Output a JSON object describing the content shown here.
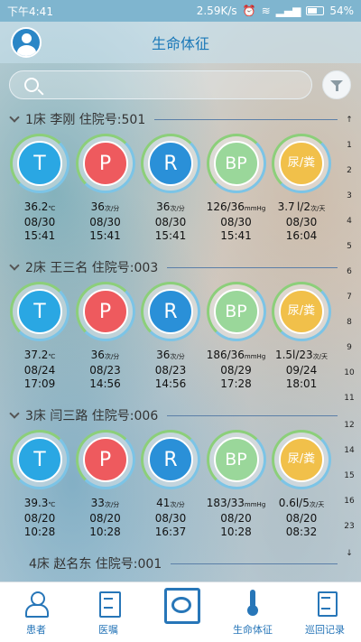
{
  "status_bar": {
    "time": "下午4:41",
    "speed": "2.59K/s",
    "icons": [
      "alarm-icon",
      "wifi-icon",
      "signal-icon"
    ],
    "battery": "54%"
  },
  "header": {
    "title": "生命体征",
    "avatar_icon": "user-avatar-icon"
  },
  "search": {
    "placeholder": "",
    "value": "",
    "filter_icon": "filter-icon"
  },
  "patients": [
    {
      "title": "1床 李刚 住院号:501",
      "vitals": [
        {
          "symbol": "T",
          "value": "36.2",
          "unit": "℃",
          "date": "08/30",
          "time": "15:41"
        },
        {
          "symbol": "P",
          "value": "36",
          "unit": "次/分",
          "date": "08/30",
          "time": "15:41"
        },
        {
          "symbol": "R",
          "value": "36",
          "unit": "次/分",
          "date": "08/30",
          "time": "15:41"
        },
        {
          "symbol": "BP",
          "value": "126/36",
          "unit": "mmHg",
          "date": "08/30",
          "time": "15:41"
        },
        {
          "symbol": "尿/粪",
          "value": "3.7 l/2",
          "unit": "次/天",
          "date": "08/30",
          "time": "16:04"
        }
      ]
    },
    {
      "title": "2床 王三名 住院号:003",
      "vitals": [
        {
          "symbol": "T",
          "value": "37.2",
          "unit": "℃",
          "date": "08/24",
          "time": "17:09"
        },
        {
          "symbol": "P",
          "value": "36",
          "unit": "次/分",
          "date": "08/23",
          "time": "14:56"
        },
        {
          "symbol": "R",
          "value": "36",
          "unit": "次/分",
          "date": "08/23",
          "time": "14:56"
        },
        {
          "symbol": "BP",
          "value": "186/36",
          "unit": "mmHg",
          "date": "08/29",
          "time": "17:28"
        },
        {
          "symbol": "尿/粪",
          "value": "1.5l/23",
          "unit": "次/天",
          "date": "09/24",
          "time": "18:01"
        }
      ]
    },
    {
      "title": "3床 闫三路 住院号:006",
      "vitals": [
        {
          "symbol": "T",
          "value": "39.3",
          "unit": "℃",
          "date": "08/20",
          "time": "10:28"
        },
        {
          "symbol": "P",
          "value": "33",
          "unit": "次/分",
          "date": "08/20",
          "time": "10:28"
        },
        {
          "symbol": "R",
          "value": "41",
          "unit": "次/分",
          "date": "08/30",
          "time": "16:37"
        },
        {
          "symbol": "BP",
          "value": "183/33",
          "unit": "mmHg",
          "date": "08/20",
          "time": "10:28"
        },
        {
          "symbol": "尿/粪",
          "value": "0.6l/5",
          "unit": "次/天",
          "date": "08/20",
          "time": "08:32"
        }
      ]
    },
    {
      "title": "4床 赵名东 住院号:001",
      "vitals": []
    }
  ],
  "side_index": [
    "↑",
    "1",
    "2",
    "3",
    "4",
    "5",
    "6",
    "7",
    "8",
    "9",
    "10",
    "11",
    "12",
    "14",
    "15",
    "16",
    "23",
    "↓"
  ],
  "bottom_nav": [
    {
      "label": "患者",
      "icon": "patient-icon"
    },
    {
      "label": "医嘱",
      "icon": "medical-order-icon"
    },
    {
      "label": "",
      "icon": "scan-icon"
    },
    {
      "label": "生命体征",
      "icon": "thermometer-icon"
    },
    {
      "label": "巡回记录",
      "icon": "round-record-icon"
    }
  ]
}
